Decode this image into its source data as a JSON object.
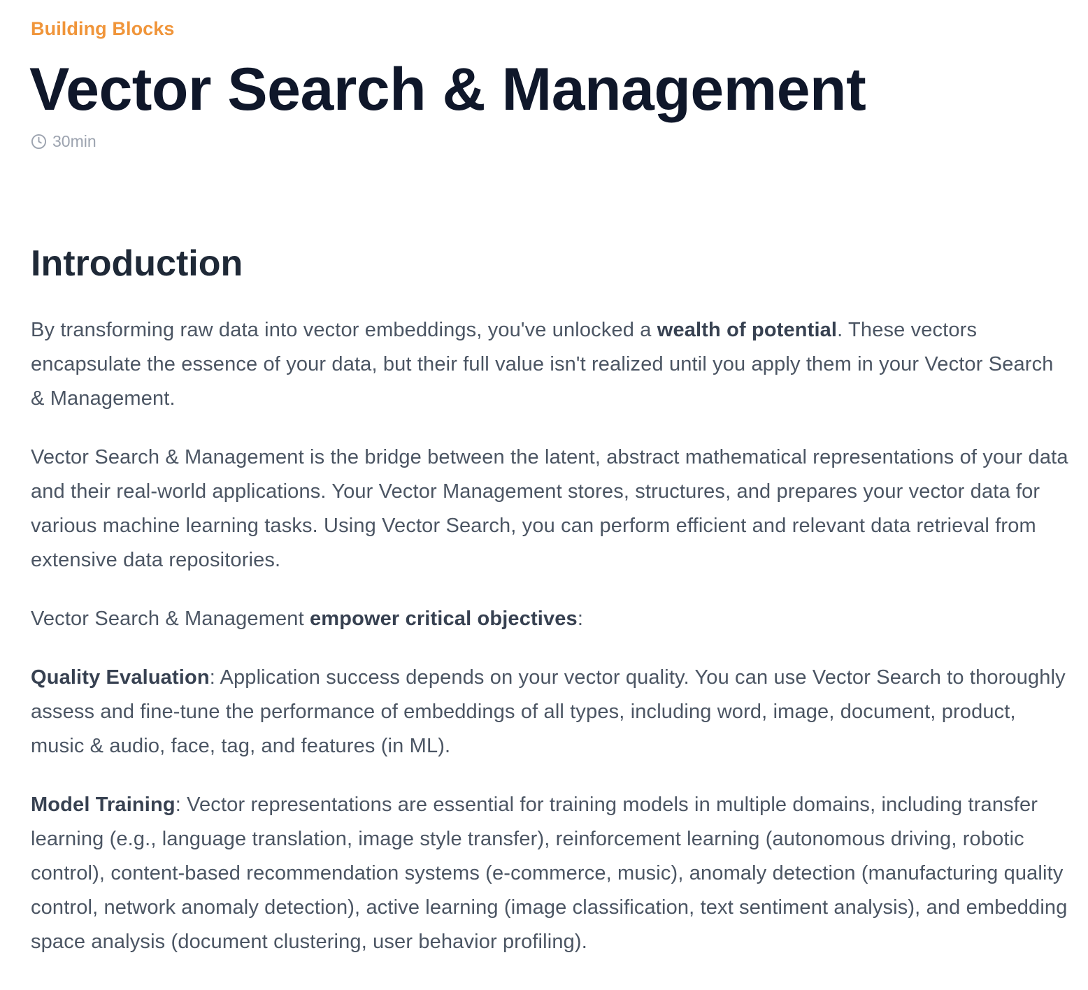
{
  "header": {
    "category_link": "Building Blocks",
    "title": "Vector Search & Management",
    "duration": "30min",
    "duration_icon": "clock-icon"
  },
  "intro": {
    "heading": "Introduction",
    "p1": {
      "before": "By transforming raw data into vector embeddings, you've unlocked a ",
      "bold": "wealth of potential",
      "after": ". These vectors encapsulate the essence of your data, but their full value isn't realized until you apply them in your Vector Search & Management."
    },
    "p2": "Vector Search & Management is the bridge between the latent, abstract mathematical representations of your data and their real-world applications. Your Vector Management stores, structures, and prepares your vector data for various machine learning tasks. Using Vector Search, you can perform efficient and relevant data retrieval from extensive data repositories.",
    "p3": {
      "before": "Vector Search & Management ",
      "bold": "empower critical objectives",
      "after": ":"
    },
    "quality": {
      "label": "Quality Evaluation",
      "text": ": Application success depends on your vector quality. You can use Vector Search to thoroughly assess and fine-tune the performance of embeddings of all types, including word, image, document, product, music & audio, face, tag, and features (in ML)."
    },
    "training": {
      "label": "Model Training",
      "text": ": Vector representations are essential for training models in multiple domains, including transfer learning (e.g., language translation, image style transfer), reinforcement learning (autonomous driving, robotic control), content-based recommendation systems (e-commerce, music), anomaly detection (manufacturing quality control, network anomaly detection), active learning (image classification, text sentiment analysis), and embedding space analysis (document clustering, user behavior profiling)."
    }
  },
  "colors": {
    "accent": "#f0953a",
    "title": "#0f172a",
    "body": "#4b5563",
    "muted": "#9ca3af"
  }
}
